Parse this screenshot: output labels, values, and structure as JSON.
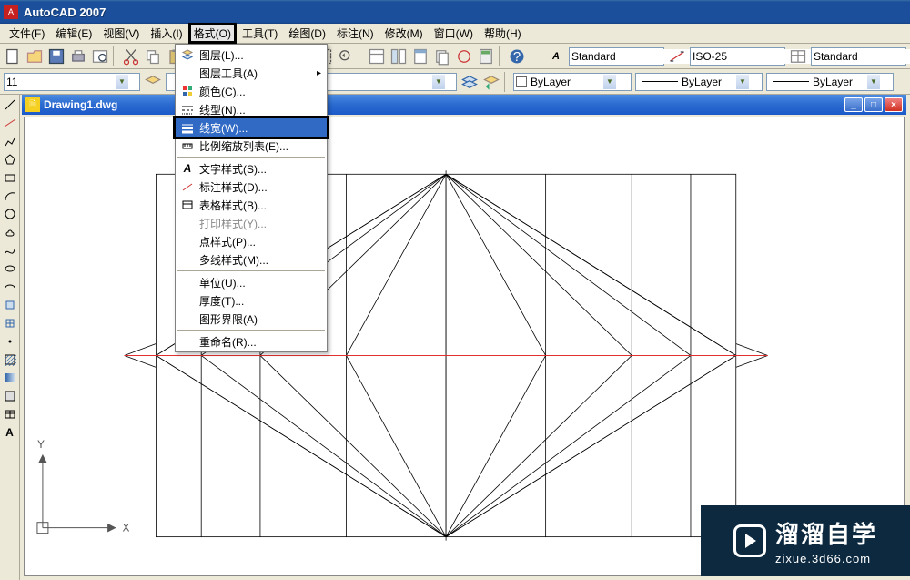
{
  "app": {
    "title": "AutoCAD 2007"
  },
  "menubar": [
    "文件(F)",
    "编辑(E)",
    "视图(V)",
    "插入(I)",
    "格式(O)",
    "工具(T)",
    "绘图(D)",
    "标注(N)",
    "修改(M)",
    "窗口(W)",
    "帮助(H)"
  ],
  "menubar_highlight_index": 4,
  "toolbar2": {
    "font_select": "11",
    "style1": "Standard",
    "style2": "ISO-25",
    "style3": "Standard",
    "layer_color": "ByLayer",
    "lineweight1": "ByLayer",
    "lineweight2": "ByLayer"
  },
  "doc": {
    "title": "Drawing1.dwg"
  },
  "format_menu": [
    {
      "label": "图层(L)...",
      "icon": "layers"
    },
    {
      "label": "图层工具(A)",
      "submenu": true
    },
    {
      "label": "颜色(C)...",
      "icon": "palette"
    },
    {
      "label": "线型(N)...",
      "icon": "linetype"
    },
    {
      "label": "线宽(W)...",
      "icon": "lineweight",
      "highlight": true
    },
    {
      "label": "比例缩放列表(E)...",
      "icon": "scale"
    },
    {
      "sep": true
    },
    {
      "label": "文字样式(S)...",
      "icon": "textstyle"
    },
    {
      "label": "标注样式(D)...",
      "icon": "dimstyle"
    },
    {
      "label": "表格样式(B)...",
      "icon": "tablestyle"
    },
    {
      "label": "打印样式(Y)...",
      "disabled": true
    },
    {
      "label": "点样式(P)..."
    },
    {
      "label": "多线样式(M)..."
    },
    {
      "sep": true
    },
    {
      "label": "单位(U)..."
    },
    {
      "label": "厚度(T)..."
    },
    {
      "label": "图形界限(A)"
    },
    {
      "sep": true
    },
    {
      "label": "重命名(R)..."
    }
  ],
  "ucs": {
    "x_label": "X",
    "y_label": "Y"
  },
  "watermark": {
    "big": "溜溜自学",
    "small": "zixue.3d66.com"
  }
}
